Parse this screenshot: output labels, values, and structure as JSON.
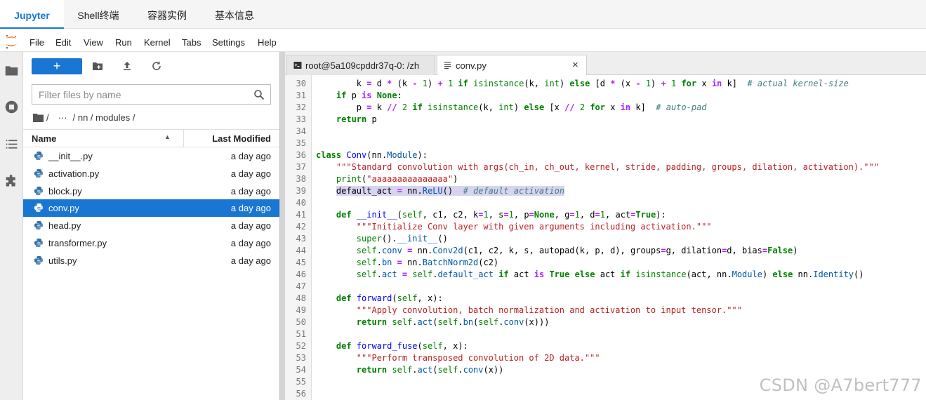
{
  "top_tabs": [
    {
      "label": "Jupyter",
      "active": true
    },
    {
      "label": "Shell终端",
      "active": false
    },
    {
      "label": "容器实例",
      "active": false
    },
    {
      "label": "基本信息",
      "active": false
    }
  ],
  "menu": [
    "File",
    "Edit",
    "View",
    "Run",
    "Kernel",
    "Tabs",
    "Settings",
    "Help"
  ],
  "activity_icons": [
    "folder-icon",
    "running-icon",
    "toc-icon",
    "extension-icon"
  ],
  "file_browser": {
    "new_label": "+",
    "filter_placeholder": "Filter files by name",
    "breadcrumb": {
      "sep1": "/",
      "ellipsis": "···",
      "path": "/ nn / modules /"
    },
    "columns": {
      "name": "Name",
      "modified": "Last Modified"
    },
    "files": [
      {
        "name": "__init__.py",
        "modified": "a day ago",
        "selected": false
      },
      {
        "name": "activation.py",
        "modified": "a day ago",
        "selected": false
      },
      {
        "name": "block.py",
        "modified": "a day ago",
        "selected": false
      },
      {
        "name": "conv.py",
        "modified": "a day ago",
        "selected": true
      },
      {
        "name": "head.py",
        "modified": "a day ago",
        "selected": false
      },
      {
        "name": "transformer.py",
        "modified": "a day ago",
        "selected": false
      },
      {
        "name": "utils.py",
        "modified": "a day ago",
        "selected": false
      }
    ]
  },
  "editor_tabs": [
    {
      "label": "root@5a109cpddr37q-0: /zh",
      "active": false
    },
    {
      "label": "conv.py",
      "active": true,
      "close": "×"
    }
  ],
  "code": {
    "first_line": 30,
    "highlight_line": 39,
    "lines": [
      "        k = d * (k - 1) + 1 if isinstance(k, int) else [d * (x - 1) + 1 for x in k]  # actual kernel-size",
      "    if p is None:",
      "        p = k // 2 if isinstance(k, int) else [x // 2 for x in k]  # auto-pad",
      "    return p",
      "",
      "",
      "class Conv(nn.Module):",
      "    \"\"\"Standard convolution with args(ch_in, ch_out, kernel, stride, padding, groups, dilation, activation).\"\"\"",
      "    print(\"aaaaaaaaaaaaaaa\")",
      "    default_act = nn.ReLU()  # default activation",
      "",
      "    def __init__(self, c1, c2, k=1, s=1, p=None, g=1, d=1, act=True):",
      "        \"\"\"Initialize Conv layer with given arguments including activation.\"\"\"",
      "        super().__init__()",
      "        self.conv = nn.Conv2d(c1, c2, k, s, autopad(k, p, d), groups=g, dilation=d, bias=False)",
      "        self.bn = nn.BatchNorm2d(c2)",
      "        self.act = self.default_act if act is True else act if isinstance(act, nn.Module) else nn.Identity()",
      "",
      "    def forward(self, x):",
      "        \"\"\"Apply convolution, batch normalization and activation to input tensor.\"\"\"",
      "        return self.act(self.bn(self.conv(x)))",
      "",
      "    def forward_fuse(self, x):",
      "        \"\"\"Perform transposed convolution of 2D data.\"\"\"",
      "        return self.act(self.conv(x))",
      "",
      ""
    ]
  },
  "watermark": "CSDN @A7bert777",
  "colors": {
    "accent": "#1976d2",
    "selected_row": "#1976d2",
    "highlight": "#d7d4f0"
  }
}
